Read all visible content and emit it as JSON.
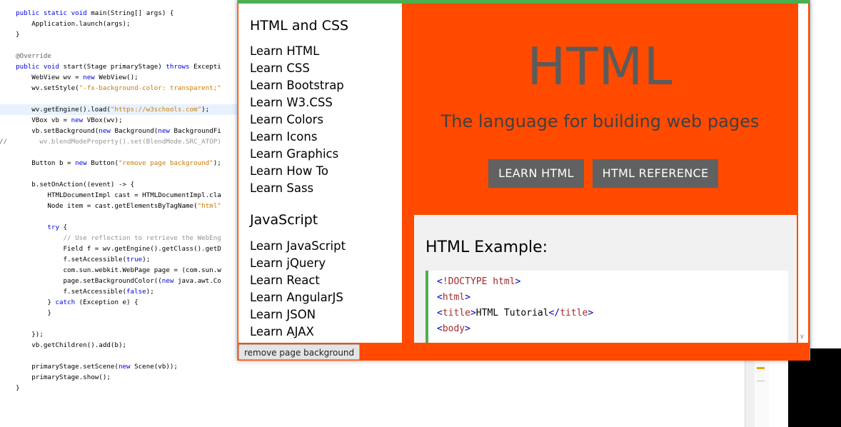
{
  "editor": {
    "gutter_marker": "//",
    "lines": [
      [
        {
          "t": "    "
        },
        {
          "t": "public static void",
          "c": "kw"
        },
        {
          "t": " main(String[] args) {"
        }
      ],
      [
        {
          "t": "        Application.launch(args);"
        }
      ],
      [
        {
          "t": "    }"
        }
      ],
      [
        {
          "t": ""
        }
      ],
      [
        {
          "t": "    "
        },
        {
          "t": "@Override",
          "c": "ann"
        }
      ],
      [
        {
          "t": "    "
        },
        {
          "t": "public void",
          "c": "kw"
        },
        {
          "t": " start(Stage primaryStage) "
        },
        {
          "t": "throws",
          "c": "kw"
        },
        {
          "t": " Excepti"
        }
      ],
      [
        {
          "t": "        WebView wv = "
        },
        {
          "t": "new",
          "c": "kw"
        },
        {
          "t": " WebView();"
        }
      ],
      [
        {
          "t": "        wv.setStyle("
        },
        {
          "t": "\"-fx-background-color: transparent;\"",
          "c": "str"
        }
      ],
      [
        {
          "t": ""
        }
      ],
      [
        {
          "t": "        wv.getEngine().load("
        },
        {
          "t": "\"https://w3schools.com\"",
          "c": "str"
        },
        {
          "t": ");"
        }
      ],
      [
        {
          "t": "        VBox vb = "
        },
        {
          "t": "new",
          "c": "kw"
        },
        {
          "t": " VBox(wv);"
        }
      ],
      [
        {
          "t": "        vb.setBackground("
        },
        {
          "t": "new",
          "c": "kw"
        },
        {
          "t": " Background("
        },
        {
          "t": "new",
          "c": "kw"
        },
        {
          "t": " BackgroundFi"
        }
      ],
      [
        {
          "t": "          wv.blendModeProperty().set(BlendMode.SRC_ATOP)",
          "c": "cm"
        }
      ],
      [
        {
          "t": ""
        }
      ],
      [
        {
          "t": "        Button b = "
        },
        {
          "t": "new",
          "c": "kw"
        },
        {
          "t": " Button("
        },
        {
          "t": "\"remove page background\"",
          "c": "str"
        },
        {
          "t": ");"
        }
      ],
      [
        {
          "t": ""
        }
      ],
      [
        {
          "t": "        b.setOnAction((event) -> {"
        }
      ],
      [
        {
          "t": "            HTMLDocumentImpl cast = HTMLDocumentImpl.cla"
        }
      ],
      [
        {
          "t": "            Node item = cast.getElementsByTagName("
        },
        {
          "t": "\"html\"",
          "c": "str"
        }
      ],
      [
        {
          "t": ""
        }
      ],
      [
        {
          "t": "            "
        },
        {
          "t": "try",
          "c": "kw"
        },
        {
          "t": " {"
        }
      ],
      [
        {
          "t": "                "
        },
        {
          "t": "// Use reflection to retrieve the WebEng",
          "c": "cm"
        }
      ],
      [
        {
          "t": "                Field f = wv.getEngine().getClass().getD"
        }
      ],
      [
        {
          "t": "                f.setAccessible("
        },
        {
          "t": "true",
          "c": "kw"
        },
        {
          "t": ");"
        }
      ],
      [
        {
          "t": "                com.sun.webkit.WebPage page = (com.sun.w"
        }
      ],
      [
        {
          "t": "                page.setBackgroundColor(("
        },
        {
          "t": "new",
          "c": "kw"
        },
        {
          "t": " java.awt.Co"
        }
      ],
      [
        {
          "t": "                f.setAccessible("
        },
        {
          "t": "false",
          "c": "kw"
        },
        {
          "t": ");"
        }
      ],
      [
        {
          "t": "            } "
        },
        {
          "t": "catch",
          "c": "kw"
        },
        {
          "t": " (Exception e) {"
        }
      ],
      [
        {
          "t": "            }"
        }
      ],
      [
        {
          "t": ""
        }
      ],
      [
        {
          "t": "        });"
        }
      ],
      [
        {
          "t": "        vb.getChildren().add(b);"
        }
      ],
      [
        {
          "t": ""
        }
      ],
      [
        {
          "t": "        primaryStage.setScene("
        },
        {
          "t": "new",
          "c": "kw"
        },
        {
          "t": " Scene(vb));"
        }
      ],
      [
        {
          "t": "        primaryStage.show();"
        }
      ],
      [
        {
          "t": "    }"
        }
      ]
    ]
  },
  "sidebar": {
    "html_css_heading": "HTML and CSS",
    "html_css_links": [
      "Learn HTML",
      "Learn CSS",
      "Learn Bootstrap",
      "Learn W3.CSS",
      "Learn Colors",
      "Learn Icons",
      "Learn Graphics",
      "Learn How To",
      "Learn Sass"
    ],
    "js_heading": "JavaScript",
    "js_links": [
      "Learn JavaScript",
      "Learn jQuery",
      "Learn React",
      "Learn AngularJS",
      "Learn JSON",
      "Learn AJAX"
    ]
  },
  "main": {
    "title": "HTML",
    "subtitle": "The language for building web pages",
    "learn_button": "LEARN HTML",
    "reference_button": "HTML REFERENCE",
    "example_title": "HTML Example:",
    "example_code": [
      {
        "open": "<",
        "name": "!DOCTYPE html",
        "close": ">",
        "text": ""
      },
      {
        "open": "<",
        "name": "html",
        "close": ">",
        "text": ""
      },
      {
        "open": "<",
        "name": "title",
        "close": ">",
        "text": "HTML Tutorial",
        "end_open": "</",
        "end_name": "title",
        "end_close": ">"
      },
      {
        "open": "<",
        "name": "body",
        "close": ">",
        "text": ""
      }
    ]
  },
  "app": {
    "remove_button": "remove page background"
  },
  "colors": {
    "page_background": "#ff4a00",
    "top_bar": "#4caf50",
    "button_bg": "#616161"
  }
}
